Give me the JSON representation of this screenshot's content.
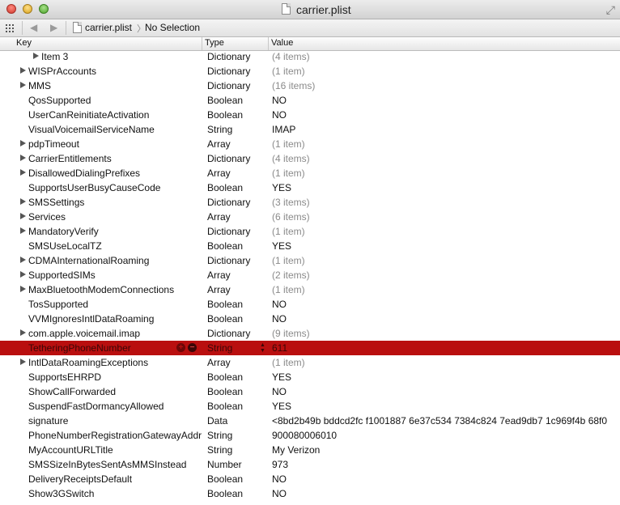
{
  "window": {
    "title": "carrier.plist"
  },
  "pathbar": {
    "back": "◀",
    "forward": "▶",
    "file": "carrier.plist",
    "chevron": "〉",
    "selection": "No Selection"
  },
  "columns": {
    "key": "Key",
    "type": "Type",
    "value": "Value"
  },
  "rows": [
    {
      "key": "Item 3",
      "type": "Dictionary",
      "value": "(4 items)",
      "indent": 2,
      "expandable": true,
      "dim": true
    },
    {
      "key": "WISPrAccounts",
      "type": "Dictionary",
      "value": "(1 item)",
      "indent": 1,
      "expandable": true,
      "dim": true
    },
    {
      "key": "MMS",
      "type": "Dictionary",
      "value": "(16 items)",
      "indent": 1,
      "expandable": true,
      "dim": true
    },
    {
      "key": "QosSupported",
      "type": "Boolean",
      "value": "NO",
      "indent": 1,
      "expandable": false,
      "dim": false
    },
    {
      "key": "UserCanReinitiateActivation",
      "type": "Boolean",
      "value": "NO",
      "indent": 1,
      "expandable": false,
      "dim": false
    },
    {
      "key": "VisualVoicemailServiceName",
      "type": "String",
      "value": "IMAP",
      "indent": 1,
      "expandable": false,
      "dim": false
    },
    {
      "key": "pdpTimeout",
      "type": "Array",
      "value": "(1 item)",
      "indent": 1,
      "expandable": true,
      "dim": true
    },
    {
      "key": "CarrierEntitlements",
      "type": "Dictionary",
      "value": "(4 items)",
      "indent": 1,
      "expandable": true,
      "dim": true
    },
    {
      "key": "DisallowedDialingPrefixes",
      "type": "Array",
      "value": "(1 item)",
      "indent": 1,
      "expandable": true,
      "dim": true
    },
    {
      "key": "SupportsUserBusyCauseCode",
      "type": "Boolean",
      "value": "YES",
      "indent": 1,
      "expandable": false,
      "dim": false
    },
    {
      "key": "SMSSettings",
      "type": "Dictionary",
      "value": "(3 items)",
      "indent": 1,
      "expandable": true,
      "dim": true
    },
    {
      "key": "Services",
      "type": "Array",
      "value": "(6 items)",
      "indent": 1,
      "expandable": true,
      "dim": true
    },
    {
      "key": "MandatoryVerify",
      "type": "Dictionary",
      "value": "(1 item)",
      "indent": 1,
      "expandable": true,
      "dim": true
    },
    {
      "key": "SMSUseLocalTZ",
      "type": "Boolean",
      "value": "YES",
      "indent": 1,
      "expandable": false,
      "dim": false
    },
    {
      "key": "CDMAInternationalRoaming",
      "type": "Dictionary",
      "value": "(1 item)",
      "indent": 1,
      "expandable": true,
      "dim": true
    },
    {
      "key": "SupportedSIMs",
      "type": "Array",
      "value": "(2 items)",
      "indent": 1,
      "expandable": true,
      "dim": true
    },
    {
      "key": "MaxBluetoothModemConnections",
      "type": "Array",
      "value": "(1 item)",
      "indent": 1,
      "expandable": true,
      "dim": true
    },
    {
      "key": "TosSupported",
      "type": "Boolean",
      "value": "NO",
      "indent": 1,
      "expandable": false,
      "dim": false
    },
    {
      "key": "VVMIgnoresIntlDataRoaming",
      "type": "Boolean",
      "value": "NO",
      "indent": 1,
      "expandable": false,
      "dim": false
    },
    {
      "key": "com.apple.voicemail.imap",
      "type": "Dictionary",
      "value": "(9 items)",
      "indent": 1,
      "expandable": true,
      "dim": true
    },
    {
      "key": "TetheringPhoneNumber",
      "type": "String",
      "value": "611",
      "indent": 1,
      "expandable": false,
      "dim": false,
      "selected": true
    },
    {
      "key": "IntlDataRoamingExceptions",
      "type": "Array",
      "value": "(1 item)",
      "indent": 1,
      "expandable": true,
      "dim": true
    },
    {
      "key": "SupportsEHRPD",
      "type": "Boolean",
      "value": "YES",
      "indent": 1,
      "expandable": false,
      "dim": false
    },
    {
      "key": "ShowCallForwarded",
      "type": "Boolean",
      "value": "NO",
      "indent": 1,
      "expandable": false,
      "dim": false
    },
    {
      "key": "SuspendFastDormancyAllowed",
      "type": "Boolean",
      "value": "YES",
      "indent": 1,
      "expandable": false,
      "dim": false
    },
    {
      "key": "signature",
      "type": "Data",
      "value": "<8bd2b49b bddcd2fc f1001887 6e37c534 7384c824 7ead9db7 1c969f4b 68f0",
      "indent": 1,
      "expandable": false,
      "dim": false
    },
    {
      "key": "PhoneNumberRegistrationGatewayAddr",
      "type": "String",
      "value": "900080006010",
      "indent": 1,
      "expandable": false,
      "dim": false
    },
    {
      "key": "MyAccountURLTitle",
      "type": "String",
      "value": "My Verizon",
      "indent": 1,
      "expandable": false,
      "dim": false
    },
    {
      "key": "SMSSizeInBytesSentAsMMSInstead",
      "type": "Number",
      "value": "973",
      "indent": 1,
      "expandable": false,
      "dim": false
    },
    {
      "key": "DeliveryReceiptsDefault",
      "type": "Boolean",
      "value": "NO",
      "indent": 1,
      "expandable": false,
      "dim": false
    },
    {
      "key": "Show3GSwitch",
      "type": "Boolean",
      "value": "NO",
      "indent": 1,
      "expandable": false,
      "dim": false
    }
  ],
  "icons": {
    "close": "close-icon",
    "minimize": "minimize-icon",
    "zoom": "zoom-icon",
    "fullscreen": "fullscreen-icon"
  },
  "colors": {
    "selection": "#b90f0f"
  }
}
